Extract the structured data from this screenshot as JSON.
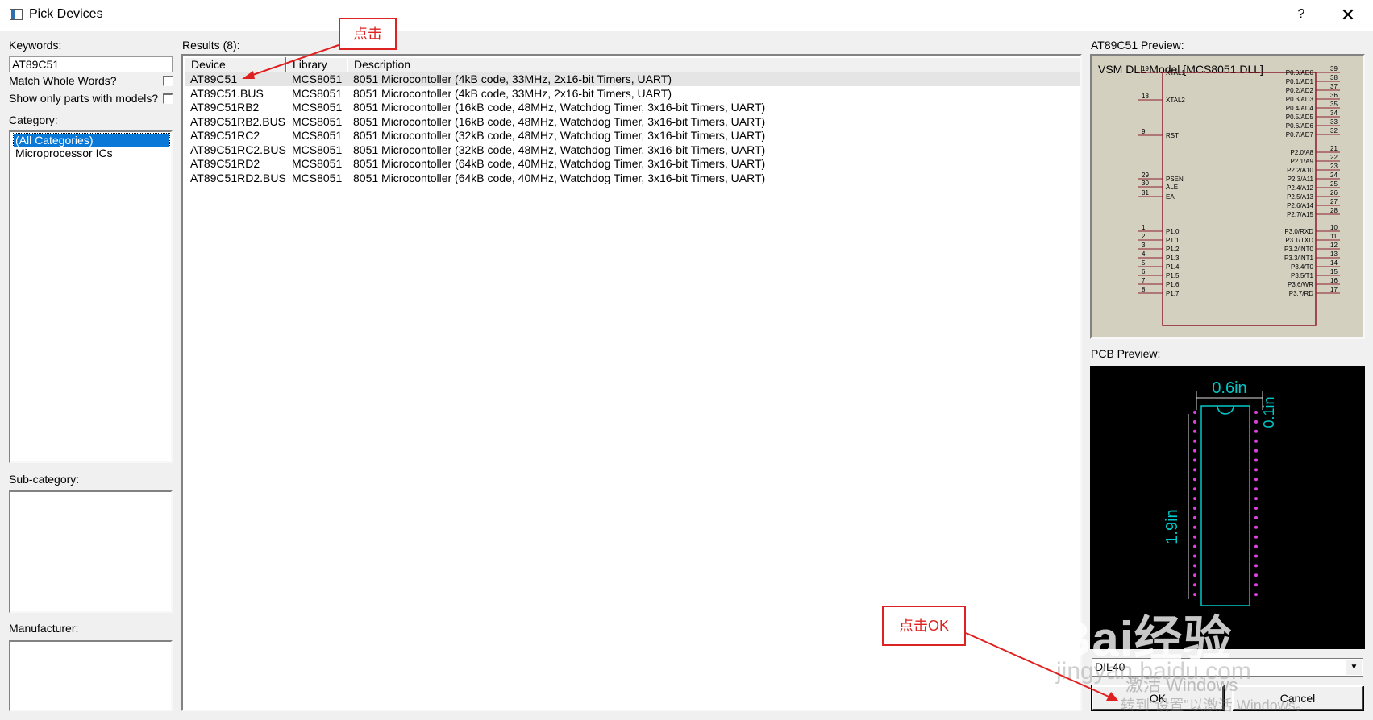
{
  "window": {
    "title": "Pick Devices",
    "help_label": "?",
    "close_label": "✕"
  },
  "left": {
    "keywords_label": "Keywords:",
    "keywords_value": "AT89C51",
    "match_whole_words_label": "Match Whole Words?",
    "show_only_models_label": "Show only parts with models?",
    "category_label": "Category:",
    "categories": [
      "(All Categories)",
      "Microprocessor ICs"
    ],
    "subcategory_label": "Sub-category:",
    "manufacturer_label": "Manufacturer:"
  },
  "results": {
    "label": "Results (8):",
    "columns": [
      "Device",
      "Library",
      "Description"
    ],
    "rows": [
      {
        "device": "AT89C51",
        "library": "MCS8051",
        "description": "8051 Microcontoller (4kB code, 33MHz, 2x16-bit Timers, UART)"
      },
      {
        "device": "AT89C51.BUS",
        "library": "MCS8051",
        "description": "8051 Microcontoller (4kB code, 33MHz, 2x16-bit Timers, UART)"
      },
      {
        "device": "AT89C51RB2",
        "library": "MCS8051",
        "description": "8051 Microcontoller (16kB code, 48MHz, Watchdog Timer, 3x16-bit Timers, UART)"
      },
      {
        "device": "AT89C51RB2.BUS",
        "library": "MCS8051",
        "description": "8051 Microcontoller (16kB code, 48MHz, Watchdog Timer, 3x16-bit Timers, UART)"
      },
      {
        "device": "AT89C51RC2",
        "library": "MCS8051",
        "description": "8051 Microcontoller (32kB code, 48MHz, Watchdog Timer, 3x16-bit Timers, UART)"
      },
      {
        "device": "AT89C51RC2.BUS",
        "library": "MCS8051",
        "description": "8051 Microcontoller (32kB code, 48MHz, Watchdog Timer, 3x16-bit Timers, UART)"
      },
      {
        "device": "AT89C51RD2",
        "library": "MCS8051",
        "description": "8051 Microcontoller (64kB code, 40MHz, Watchdog Timer, 3x16-bit Timers, UART)"
      },
      {
        "device": "AT89C51RD2.BUS",
        "library": "MCS8051",
        "description": "8051 Microcontoller (64kB code, 40MHz, Watchdog Timer, 3x16-bit Timers, UART)"
      }
    ]
  },
  "preview": {
    "schematic_label": "AT89C51 Preview:",
    "model_text": "VSM DLL Model [MCS8051.DLL]",
    "left_pins": [
      {
        "num": "19",
        "name": "XTAL1"
      },
      {
        "num": "18",
        "name": "XTAL2"
      },
      {
        "num": "9",
        "name": "RST"
      },
      {
        "num": "29",
        "name": "PSEN"
      },
      {
        "num": "30",
        "name": "ALE"
      },
      {
        "num": "31",
        "name": "EA"
      },
      {
        "num": "1",
        "name": "P1.0"
      },
      {
        "num": "2",
        "name": "P1.1"
      },
      {
        "num": "3",
        "name": "P1.2"
      },
      {
        "num": "4",
        "name": "P1.3"
      },
      {
        "num": "5",
        "name": "P1.4"
      },
      {
        "num": "6",
        "name": "P1.5"
      },
      {
        "num": "7",
        "name": "P1.6"
      },
      {
        "num": "8",
        "name": "P1.7"
      }
    ],
    "right_pins": [
      {
        "num": "39",
        "name": "P0.0/AD0"
      },
      {
        "num": "38",
        "name": "P0.1/AD1"
      },
      {
        "num": "37",
        "name": "P0.2/AD2"
      },
      {
        "num": "36",
        "name": "P0.3/AD3"
      },
      {
        "num": "35",
        "name": "P0.4/AD4"
      },
      {
        "num": "34",
        "name": "P0.5/AD5"
      },
      {
        "num": "33",
        "name": "P0.6/AD6"
      },
      {
        "num": "32",
        "name": "P0.7/AD7"
      },
      {
        "num": "21",
        "name": "P2.0/A8"
      },
      {
        "num": "22",
        "name": "P2.1/A9"
      },
      {
        "num": "23",
        "name": "P2.2/A10"
      },
      {
        "num": "24",
        "name": "P2.3/A11"
      },
      {
        "num": "25",
        "name": "P2.4/A12"
      },
      {
        "num": "26",
        "name": "P2.5/A13"
      },
      {
        "num": "27",
        "name": "P2.6/A14"
      },
      {
        "num": "28",
        "name": "P2.7/A15"
      },
      {
        "num": "10",
        "name": "P3.0/RXD"
      },
      {
        "num": "11",
        "name": "P3.1/TXD"
      },
      {
        "num": "12",
        "name": "P3.2/INT0"
      },
      {
        "num": "13",
        "name": "P3.3/INT1"
      },
      {
        "num": "14",
        "name": "P3.4/T0"
      },
      {
        "num": "15",
        "name": "P3.5/T1"
      },
      {
        "num": "16",
        "name": "P3.6/WR"
      },
      {
        "num": "17",
        "name": "P3.7/RD"
      }
    ],
    "pcb_label": "PCB Preview:",
    "pcb_width_dim": "0.6in",
    "pcb_height_dim": "1.9in",
    "pcb_pitch_dim": "0.1in",
    "package_value": "DIL40"
  },
  "buttons": {
    "ok": "OK",
    "cancel": "Cancel"
  },
  "annotations": {
    "click": "点击",
    "click_ok": "点击OK"
  },
  "watermark": {
    "brand": "Bai经验",
    "site": "jingyan.baidu.com",
    "activate": "激活 Windows",
    "activate_sub": "转到\"设置\"以激活 Windows。"
  }
}
